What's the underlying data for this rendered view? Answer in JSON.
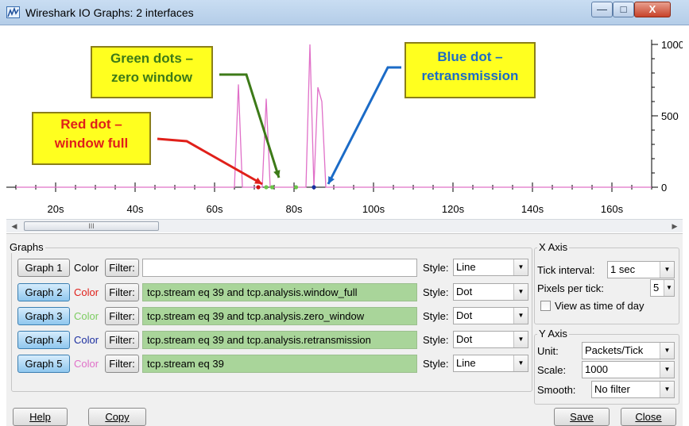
{
  "window": {
    "title": "Wireshark IO Graphs: 2 interfaces",
    "min_glyph": "—",
    "max_glyph": "□",
    "close_glyph": "X"
  },
  "chart_data": {
    "type": "line",
    "x_ticks": [
      "20s",
      "40s",
      "60s",
      "80s",
      "100s",
      "120s",
      "140s",
      "160s"
    ],
    "y_ticks": [
      "1000",
      "500",
      "0"
    ],
    "xlim": [
      10,
      170
    ],
    "ylim": [
      0,
      1000
    ],
    "series": [
      {
        "color": "#e070c8",
        "points": [
          [
            10,
            0
          ],
          [
            65,
            0
          ],
          [
            66,
            720
          ],
          [
            67,
            0
          ],
          [
            72,
            0
          ],
          [
            73,
            620
          ],
          [
            74,
            0
          ],
          [
            83,
            0
          ],
          [
            84,
            1000
          ],
          [
            85,
            0
          ],
          [
            86,
            700
          ],
          [
            87,
            600
          ],
          [
            88,
            0
          ],
          [
            170,
            0
          ]
        ]
      }
    ],
    "dots": [
      {
        "x": 71,
        "color": "#d01010",
        "meaning": "window full"
      },
      {
        "x": 73,
        "color": "#6cc44a",
        "meaning": "zero window"
      },
      {
        "x": 74.5,
        "color": "#6cc44a",
        "meaning": "zero window"
      },
      {
        "x": 80.5,
        "color": "#6cc44a",
        "meaning": "zero window"
      },
      {
        "x": 85,
        "color": "#1a2fa0",
        "meaning": "retransmission"
      }
    ]
  },
  "annotations": {
    "red": {
      "line1": "Red dot –",
      "line2": "window full",
      "color": "#e0201a"
    },
    "green": {
      "line1": "Green dots –",
      "line2": "zero window",
      "color": "#3d7a18"
    },
    "blue": {
      "line1": "Blue dot –",
      "line2": "retransmission",
      "color": "#1b6bc7"
    }
  },
  "scrollbar": {
    "left_arrow": "◀",
    "right_arrow": "▶",
    "thumb_grip": "III"
  },
  "graphs": {
    "title": "Graphs",
    "color_word": "Color",
    "filter_label": "Filter:",
    "style_label": "Style:",
    "rows": [
      {
        "button": "Graph 1",
        "color": "#000000",
        "filter": "",
        "style": "Line",
        "active": false
      },
      {
        "button": "Graph 2",
        "color": "#e0201a",
        "filter": "tcp.stream eq 39 and tcp.analysis.window_full",
        "style": "Dot",
        "active": true
      },
      {
        "button": "Graph 3",
        "color": "#7ccc60",
        "filter": "tcp.stream eq 39 and tcp.analysis.zero_window",
        "style": "Dot",
        "active": true
      },
      {
        "button": "Graph 4",
        "color": "#1c2fa0",
        "filter": "tcp.stream eq 39 and tcp.analysis.retransmission",
        "style": "Dot",
        "active": true
      },
      {
        "button": "Graph 5",
        "color": "#e070c8",
        "filter": "tcp.stream eq 39",
        "style": "Line",
        "active": true
      }
    ]
  },
  "x_axis": {
    "title": "X Axis",
    "tick_interval_label": "Tick interval:",
    "tick_interval": "1 sec",
    "pixels_label": "Pixels per tick:",
    "pixels": "5",
    "view_time": "View as time of day"
  },
  "y_axis": {
    "title": "Y Axis",
    "unit_label": "Unit:",
    "unit": "Packets/Tick",
    "scale_label": "Scale:",
    "scale": "1000",
    "smooth_label": "Smooth:",
    "smooth": "No filter"
  },
  "footer": {
    "help": "Help",
    "copy": "Copy",
    "save": "Save",
    "close": "Close"
  }
}
